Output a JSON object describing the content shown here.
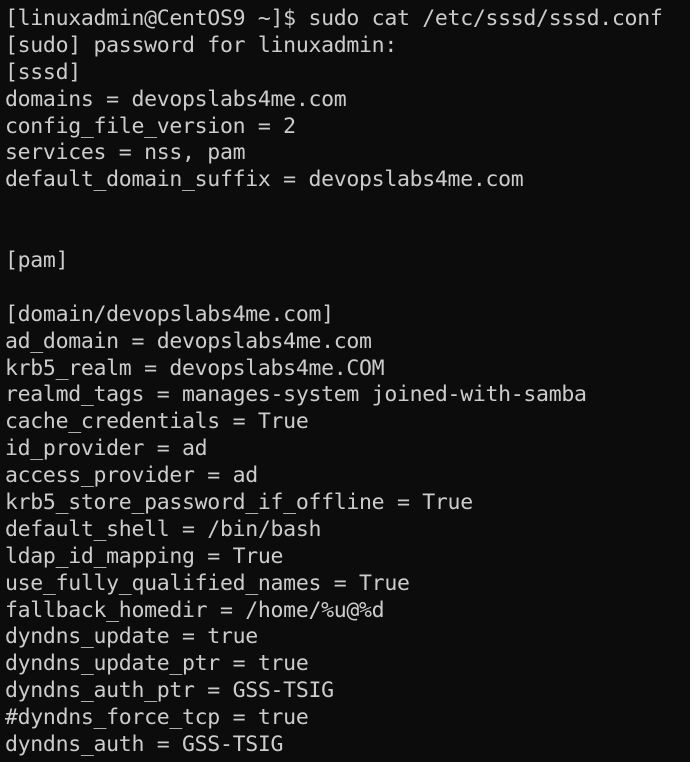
{
  "terminal": {
    "colors": {
      "background": "#0c0c0c",
      "foreground": "#cccccc"
    },
    "prompt": "[linuxadmin@CentOS9 ~]$ sudo cat /etc/sssd/sssd.conf",
    "sudo_prompt": "[sudo] password for linuxadmin:",
    "sssd_section": {
      "header": "[sssd]",
      "lines": [
        "domains = devopslabs4me.com",
        "config_file_version = 2",
        "services = nss, pam",
        "default_domain_suffix = devopslabs4me.com"
      ]
    },
    "pam_section": {
      "header": "[pam]"
    },
    "domain_section": {
      "header": "[domain/devopslabs4me.com]",
      "lines": [
        "ad_domain = devopslabs4me.com",
        "krb5_realm = devopslabs4me.COM",
        "realmd_tags = manages-system joined-with-samba",
        "cache_credentials = True",
        "id_provider = ad",
        "access_provider = ad",
        "krb5_store_password_if_offline = True",
        "default_shell = /bin/bash",
        "ldap_id_mapping = True",
        "use_fully_qualified_names = True",
        "fallback_homedir = /home/%u@%d",
        "dyndns_update = true",
        "dyndns_update_ptr = true",
        "dyndns_auth_ptr = GSS-TSIG",
        "#dyndns_force_tcp = true",
        "dyndns_auth = GSS-TSIG"
      ]
    }
  }
}
